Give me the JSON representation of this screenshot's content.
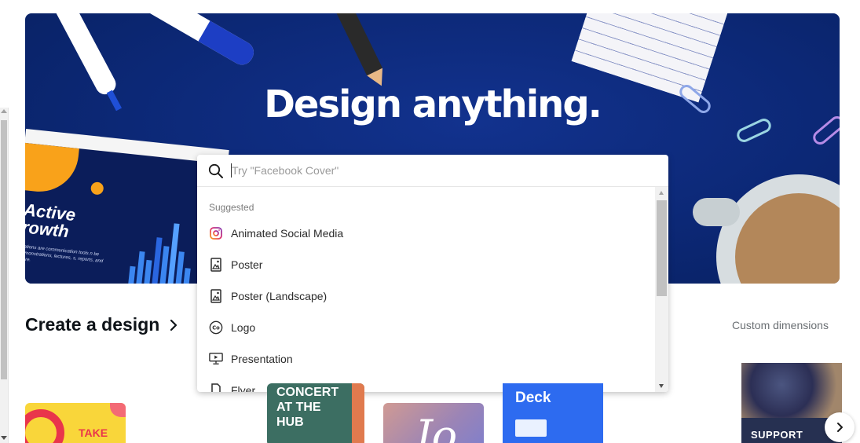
{
  "hero": {
    "title": "Design anything.",
    "slide_heading_line1": "Active",
    "slide_heading_line2": "rowth",
    "slide_body": "ntations are communication tools n be demonstrations, lectures, s, reports, and more."
  },
  "search": {
    "placeholder": "Try \"Facebook Cover\"",
    "value": ""
  },
  "dropdown": {
    "section_label": "Suggested",
    "items": [
      {
        "label": "Animated Social Media",
        "icon": "instagram-icon"
      },
      {
        "label": "Poster",
        "icon": "poster-icon"
      },
      {
        "label": "Poster (Landscape)",
        "icon": "poster-landscape-icon"
      },
      {
        "label": "Logo",
        "icon": "logo-icon"
      },
      {
        "label": "Presentation",
        "icon": "presentation-icon"
      },
      {
        "label": "Flyer",
        "icon": "flyer-icon"
      }
    ]
  },
  "section": {
    "title": "Create a design",
    "custom_dimensions": "Custom dimensions"
  },
  "cards": [
    {
      "text": "TAKE"
    },
    {
      "text": "CONCERT AT THE HUB"
    },
    {
      "text": "Jo"
    },
    {
      "text": "Deck"
    },
    {
      "text": "SUPPORT"
    }
  ],
  "colors": {
    "hero_bg": "#0c2876",
    "accent_instagram": "#e1306c"
  }
}
